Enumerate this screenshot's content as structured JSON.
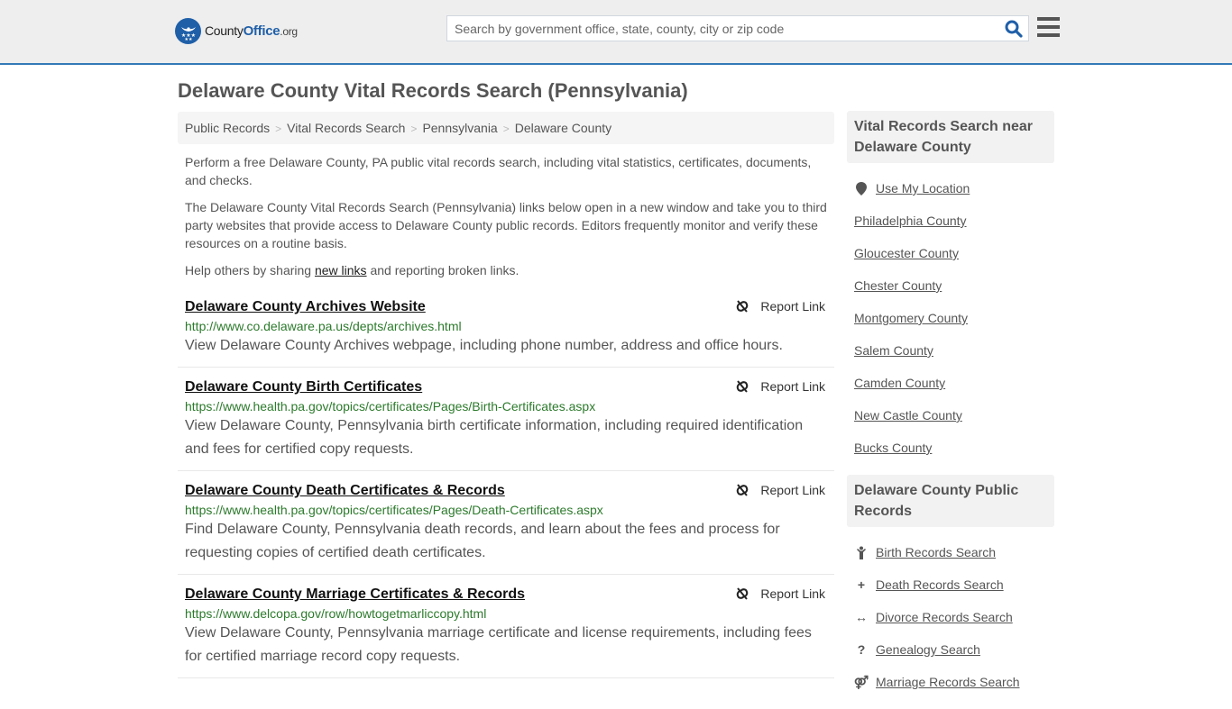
{
  "header": {
    "logo": {
      "name": "County",
      "accent": "Office",
      "tld": ".org"
    },
    "search": {
      "placeholder": "Search by government office, state, county, city or zip code",
      "value": ""
    },
    "colors": {
      "accent": "#337ab7",
      "brand": "#1f5fa8",
      "url_green": "#2c7a2c"
    }
  },
  "page": {
    "title": "Delaware County Vital Records Search (Pennsylvania)",
    "breadcrumb": [
      "Public Records",
      "Vital Records Search",
      "Pennsylvania",
      "Delaware County"
    ],
    "intro": {
      "p1": "Perform a free Delaware County, PA public vital records search, including vital statistics, certificates, documents, and checks.",
      "p2": "The Delaware County Vital Records Search (Pennsylvania) links below open in a new window and take you to third party websites that provide access to Delaware County public records. Editors frequently monitor and verify these resources on a routine basis.",
      "p3_before": "Help others by sharing ",
      "p3_link": "new links",
      "p3_after": " and reporting broken links."
    }
  },
  "results": [
    {
      "title": "Delaware County Archives Website",
      "url": "http://www.co.delaware.pa.us/depts/archives.html",
      "desc": "View Delaware County Archives webpage, including phone number, address and office hours.",
      "report": "Report Link"
    },
    {
      "title": "Delaware County Birth Certificates",
      "url": "https://www.health.pa.gov/topics/certificates/Pages/Birth-Certificates.aspx",
      "desc": "View Delaware County, Pennsylvania birth certificate information, including required identification and fees for certified copy requests.",
      "report": "Report Link"
    },
    {
      "title": "Delaware County Death Certificates & Records",
      "url": "https://www.health.pa.gov/topics/certificates/Pages/Death-Certificates.aspx",
      "desc": "Find Delaware County, Pennsylvania death records, and learn about the fees and process for requesting copies of certified death certificates.",
      "report": "Report Link"
    },
    {
      "title": "Delaware County Marriage Certificates & Records",
      "url": "https://www.delcopa.gov/row/howtogetmarliccopy.html",
      "desc": "View Delaware County, Pennsylvania marriage certificate and license requirements, including fees for certified marriage record copy requests.",
      "report": "Report Link"
    }
  ],
  "sidebar": {
    "nearby": {
      "heading": "Vital Records Search near Delaware County",
      "use_location": "Use My Location",
      "counties": [
        "Philadelphia County",
        "Gloucester County",
        "Chester County",
        "Montgomery County",
        "Salem County",
        "Camden County",
        "New Castle County",
        "Bucks County"
      ]
    },
    "public_records": {
      "heading": "Delaware County Public Records",
      "items": [
        {
          "icon": "child-icon",
          "glyph": "🯅",
          "label": "Birth Records Search"
        },
        {
          "icon": "plus-icon",
          "glyph": "+",
          "label": "Death Records Search"
        },
        {
          "icon": "arrows-horizontal-icon",
          "glyph": "↔",
          "label": "Divorce Records Search"
        },
        {
          "icon": "question-icon",
          "glyph": "?",
          "label": "Genealogy Search"
        },
        {
          "icon": "venus-mars-icon",
          "glyph": "⚤",
          "label": "Marriage Records Search"
        }
      ]
    }
  }
}
